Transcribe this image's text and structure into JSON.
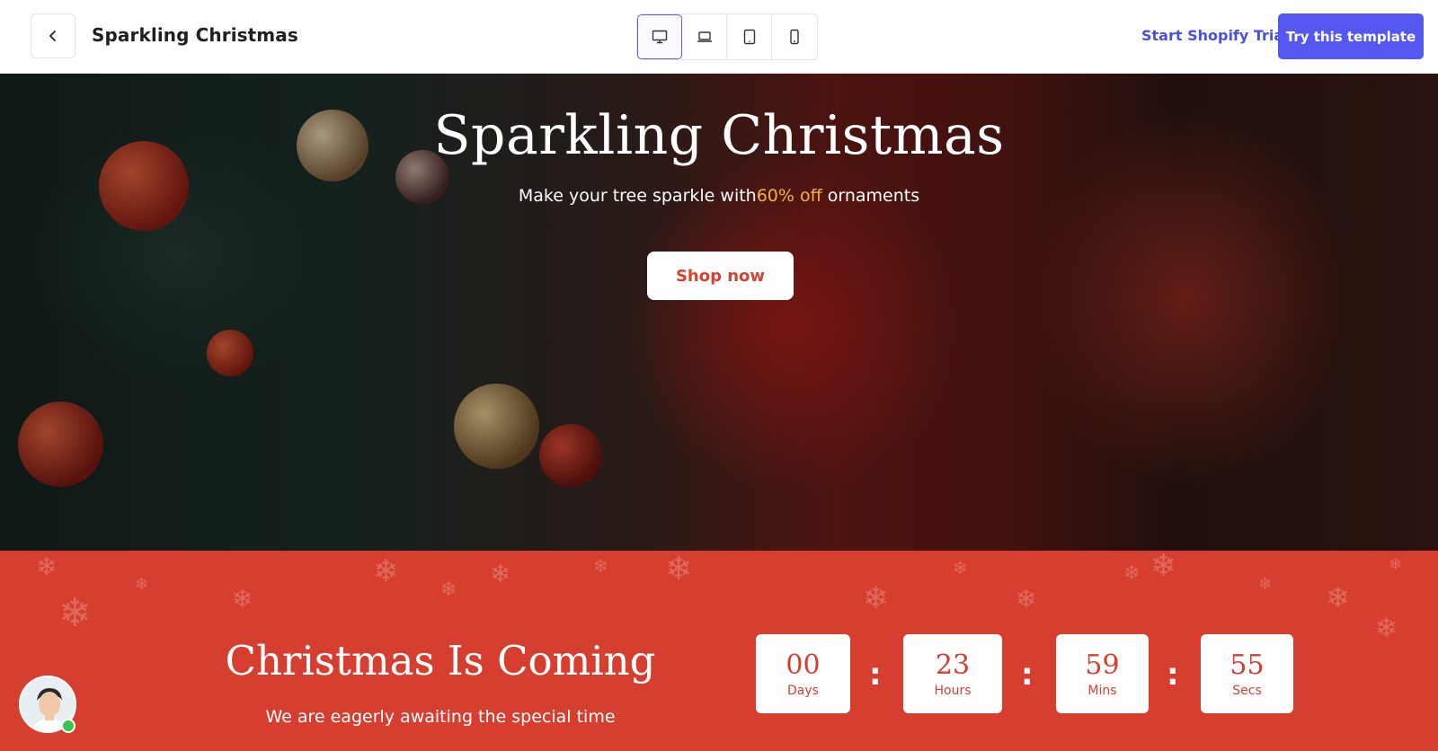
{
  "header": {
    "title": "Sparkling Christmas",
    "back_icon": "chevron-left-icon",
    "devices": [
      {
        "name": "desktop",
        "icon": "desktop-icon",
        "active": true
      },
      {
        "name": "laptop",
        "icon": "laptop-icon",
        "active": false
      },
      {
        "name": "tablet",
        "icon": "tablet-icon",
        "active": false
      },
      {
        "name": "mobile",
        "icon": "mobile-icon",
        "active": false
      }
    ],
    "trial_link": "Start Shopify Trial",
    "cta_button": "Try this template"
  },
  "hero": {
    "title": "Sparkling Christmas",
    "subtitle_before": "Make your tree sparkle with",
    "subtitle_accent": "60% off",
    "subtitle_after": " ornaments",
    "button": "Shop now"
  },
  "countdown": {
    "title": "Christmas Is Coming",
    "subtitle": "We are eagerly awaiting the special time",
    "units": [
      {
        "value": "00",
        "label": "Days"
      },
      {
        "value": "23",
        "label": "Hours"
      },
      {
        "value": "59",
        "label": "Mins"
      },
      {
        "value": "55",
        "label": "Secs"
      }
    ],
    "separator": ":"
  },
  "colors": {
    "primary": "#5457f0",
    "accent_red": "#d63f30",
    "accent_gold": "#f0b63a"
  }
}
